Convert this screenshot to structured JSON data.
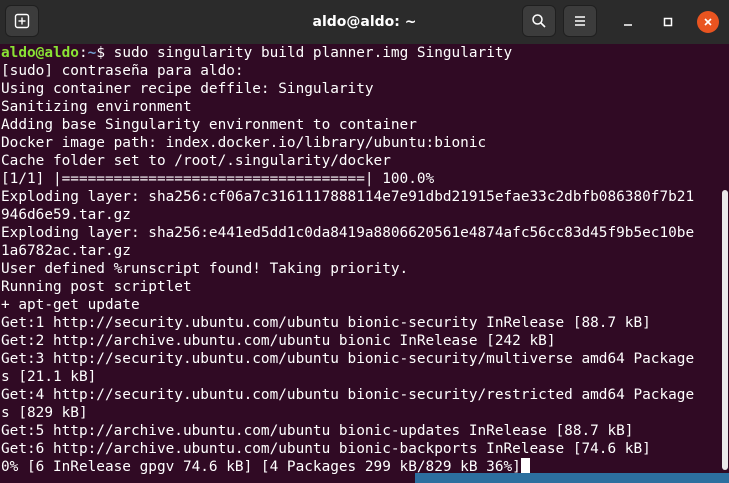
{
  "window": {
    "title": "aldo@aldo: ~"
  },
  "prompt": {
    "user_host": "aldo@aldo",
    "separator": ":",
    "path": "~",
    "symbol": "$",
    "command": " sudo singularity build planner.img Singularity"
  },
  "output": [
    "[sudo] contraseña para aldo:",
    "Using container recipe deffile: Singularity",
    "Sanitizing environment",
    "Adding base Singularity environment to container",
    "Docker image path: index.docker.io/library/ubuntu:bionic",
    "Cache folder set to /root/.singularity/docker",
    "[1/1] |===================================| 100.0%",
    "Exploding layer: sha256:cf06a7c3161117888114e7e91dbd21915efae33c2dbfb086380f7b21",
    "946d6e59.tar.gz",
    "Exploding layer: sha256:e441ed5dd1c0da8419a8806620561e4874afc56cc83d45f9b5ec10be",
    "1a6782ac.tar.gz",
    "User defined %runscript found! Taking priority.",
    "Running post scriptlet",
    "+ apt-get update",
    "Get:1 http://security.ubuntu.com/ubuntu bionic-security InRelease [88.7 kB]",
    "Get:2 http://archive.ubuntu.com/ubuntu bionic InRelease [242 kB]",
    "Get:3 http://security.ubuntu.com/ubuntu bionic-security/multiverse amd64 Package",
    "s [21.1 kB]",
    "Get:4 http://security.ubuntu.com/ubuntu bionic-security/restricted amd64 Package",
    "s [829 kB]",
    "Get:5 http://archive.ubuntu.com/ubuntu bionic-updates InRelease [88.7 kB]",
    "Get:6 http://archive.ubuntu.com/ubuntu bionic-backports InRelease [74.6 kB]"
  ],
  "last_line": "0% [6 InRelease gpgv 74.6 kB] [4 Packages 299 kB/829 kB 36%]",
  "icons": {
    "new_tab": "new-tab-icon",
    "search": "search-icon",
    "menu": "hamburger-menu-icon",
    "minimize": "minimize-icon",
    "maximize": "maximize-icon",
    "close": "close-icon"
  },
  "colors": {
    "background": "#300a24",
    "titlebar": "#2b2b2b",
    "prompt_user": "#8ae234",
    "prompt_path": "#729fcf",
    "close_button": "#e95420"
  }
}
